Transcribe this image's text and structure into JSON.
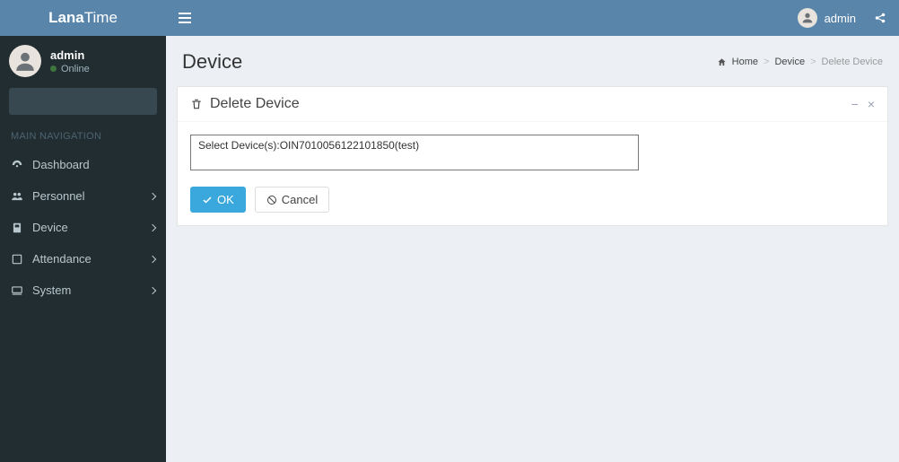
{
  "brand": {
    "part1": "Lana",
    "part2": "Time"
  },
  "topbar": {
    "username": "admin"
  },
  "sidebar": {
    "user": {
      "name": "admin",
      "status": "Online"
    },
    "nav_header": "MAIN NAVIGATION",
    "items": [
      {
        "label": "Dashboard",
        "has_children": false
      },
      {
        "label": "Personnel",
        "has_children": true
      },
      {
        "label": "Device",
        "has_children": true
      },
      {
        "label": "Attendance",
        "has_children": true
      },
      {
        "label": "System",
        "has_children": true
      }
    ]
  },
  "page": {
    "title": "Device",
    "breadcrumb": {
      "home": "Home",
      "mid": "Device",
      "leaf": "Delete Device"
    }
  },
  "box": {
    "title": "Delete Device",
    "selected_text": "Select Device(s):OIN7010056122101850(test)",
    "ok_label": "OK",
    "cancel_label": "Cancel"
  }
}
